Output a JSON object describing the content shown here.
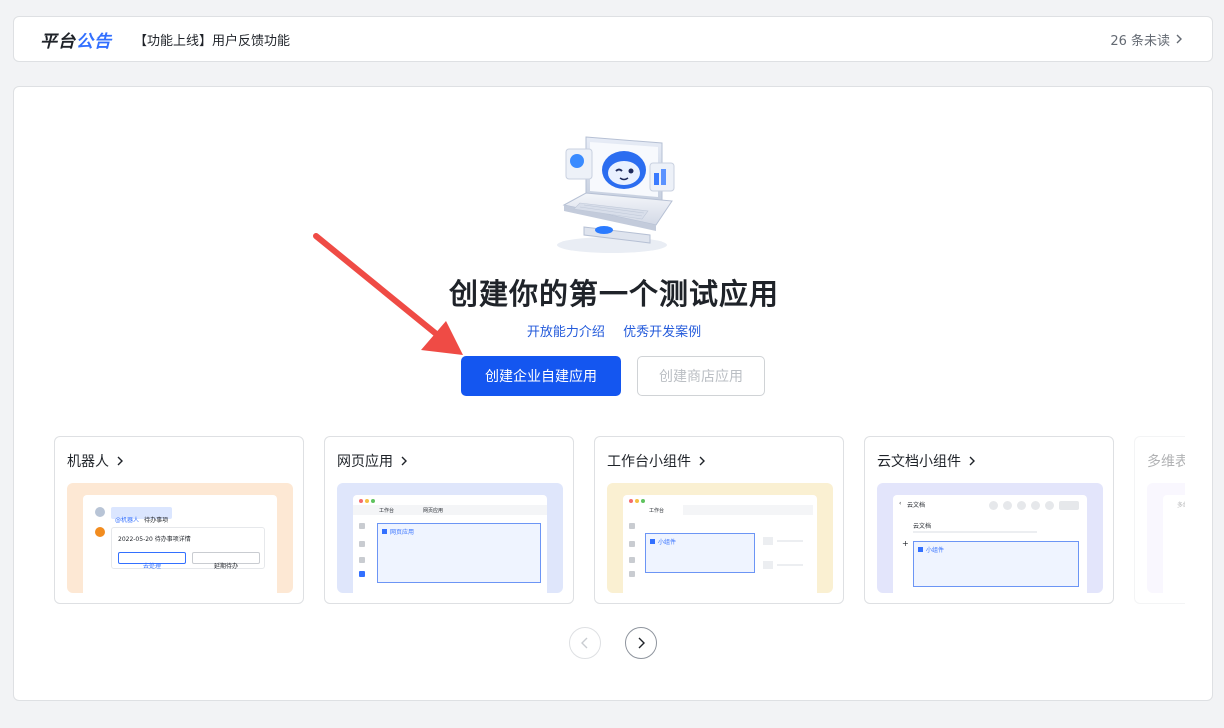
{
  "notice": {
    "brand_part1": "平台",
    "brand_part2": "公告",
    "message": "【功能上线】用户反馈功能",
    "unread": "26 条未读"
  },
  "main": {
    "title": "创建你的第一个测试应用",
    "links": [
      "开放能力介绍",
      "优秀开发案例"
    ],
    "primary_button": "创建企业自建应用",
    "secondary_button": "创建商店应用"
  },
  "cards": [
    {
      "title": "机器人",
      "preview_bg": "#fde8d4",
      "preview": {
        "tag": "@机器人",
        "tag_text": "待办事项",
        "date_line": "2022-05-20 待办事项详情",
        "btn1": "去处理",
        "btn2": "延期待办"
      }
    },
    {
      "title": "网页应用",
      "preview_bg": "#dfe6fb",
      "preview": {
        "tab1": "工作台",
        "tab2": "网页应用",
        "box_label": "网页应用"
      }
    },
    {
      "title": "工作台小组件",
      "preview_bg": "#faf0d2",
      "preview": {
        "tab1": "工作台",
        "box_label": "小组件"
      }
    },
    {
      "title": "云文档小组件",
      "preview_bg": "#e3e5fb",
      "preview": {
        "header": "云文档",
        "doc_title": "云文档",
        "box_label": "小组件"
      }
    },
    {
      "title": "多维表格",
      "preview_bg": "#efeafd",
      "preview": {
        "header": "多维表格"
      }
    }
  ],
  "colors": {
    "accent": "#1456f0",
    "link": "#245bdb",
    "annotation_arrow": "#ef4b45"
  },
  "icons": {
    "unread_chevron": "chevron-right-icon",
    "card_chevron": "chevron-right-icon",
    "prev": "chevron-left-icon",
    "next": "chevron-right-icon"
  }
}
